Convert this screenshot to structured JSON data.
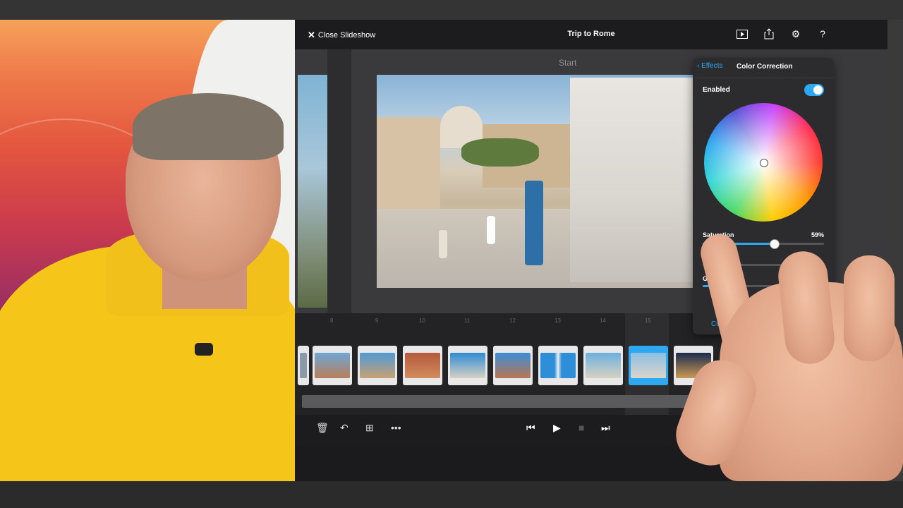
{
  "app": {
    "title": "Trip to Rome",
    "close_label": "Close Slideshow"
  },
  "topbar_icons": [
    "play-preview-icon",
    "share-icon",
    "gear-icon",
    "help-icon"
  ],
  "preview": {
    "start_label": "Start"
  },
  "timeline": {
    "ticks": [
      "8",
      "9",
      "10",
      "11",
      "12",
      "13",
      "14",
      "15"
    ],
    "selected_index": 7
  },
  "controls": {
    "left": [
      "trash-icon",
      "undo-icon",
      "add-slide-icon",
      "more-icon"
    ],
    "transport": [
      "skip-back-icon",
      "play-icon",
      "stop-icon",
      "skip-forward-icon"
    ]
  },
  "effects_panel": {
    "back_label": "Effects",
    "title": "Color Correction",
    "enabled_label": "Enabled",
    "enabled": true,
    "saturation_label": "Saturation",
    "saturation_value": "59%",
    "saturation": 0.59,
    "contrast_label": "Co",
    "gamma_label": "Gam",
    "copy_label": "Copy"
  },
  "colors": {
    "accent": "#2ea8f0",
    "shirt": "#f5c51a"
  }
}
